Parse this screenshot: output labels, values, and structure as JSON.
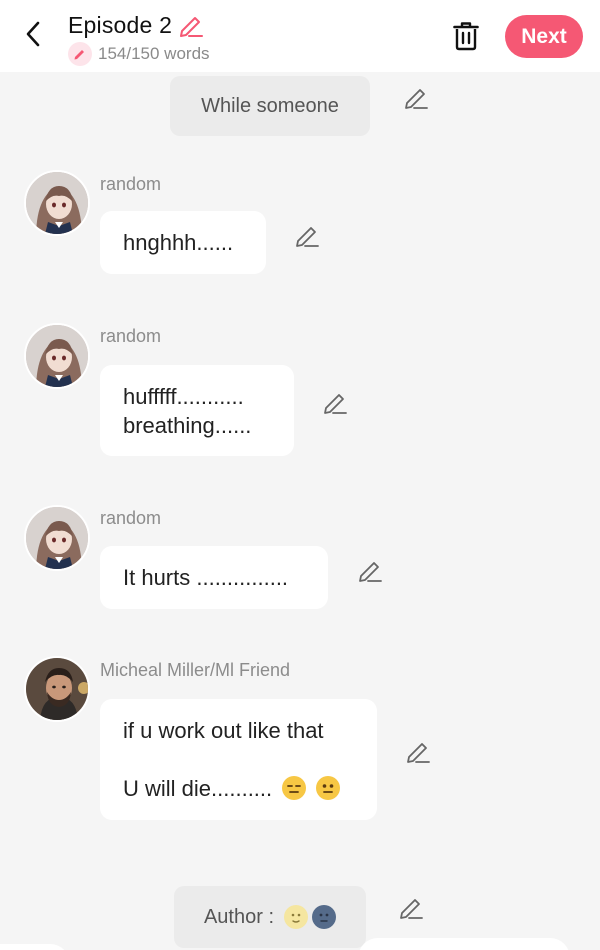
{
  "header": {
    "title": "Episode 2",
    "word_count": "154/150 words",
    "next_label": "Next",
    "accent_color": "#f55874"
  },
  "messages": [
    {
      "type": "narration",
      "text": "While someone"
    },
    {
      "type": "dialogue",
      "sender": "random",
      "lines": [
        "hnghhh......"
      ]
    },
    {
      "type": "dialogue",
      "sender": "random",
      "lines": [
        "hufffff...........",
        "breathing......"
      ]
    },
    {
      "type": "dialogue",
      "sender": "random",
      "lines": [
        "It hurts ..............."
      ]
    },
    {
      "type": "dialogue",
      "sender": "Micheal Miller/Ml Friend",
      "lines": [
        "if u work out like that",
        "",
        "U will die.........."
      ]
    },
    {
      "type": "narration",
      "text": "Author :"
    }
  ],
  "icons": {
    "back": "chevron-left-icon",
    "title_edit": "pencil-icon",
    "words": "pencil-badge-icon",
    "delete": "trash-icon",
    "message_edit": "pencil-icon"
  }
}
